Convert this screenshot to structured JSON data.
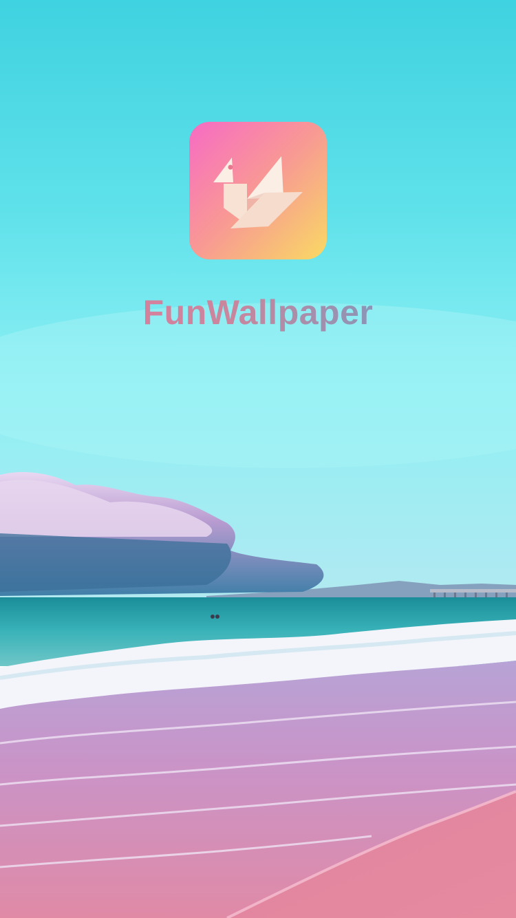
{
  "splash": {
    "app_name": "FunWallpaper",
    "logo_icon": "origami-bird-icon",
    "background": "beach-sunset-scene"
  },
  "colors": {
    "icon_gradient": [
      "#f76bc4",
      "#f89a93",
      "#f9d963"
    ],
    "title_gradient": [
      "#e9789c",
      "#c9869d",
      "#4aa5d0"
    ],
    "sky": "#6fdbea",
    "sea": "#2fa3ad",
    "sand": "#e0849f"
  }
}
